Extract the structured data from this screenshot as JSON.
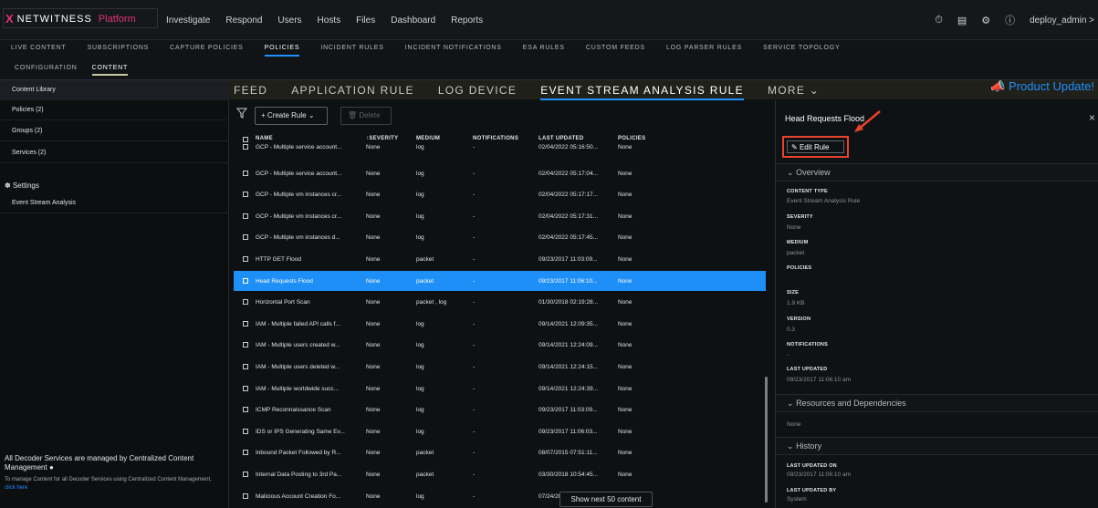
{
  "brand": {
    "logo_mark": "X",
    "name": "NETWITNESS",
    "product": "Platform"
  },
  "main_nav": [
    "Investigate",
    "Respond",
    "Users",
    "Hosts",
    "Files",
    "Dashboard",
    "Reports"
  ],
  "top_right": {
    "user": "deploy_admin >",
    "icons": [
      "timer-icon",
      "tasks-icon",
      "tools-icon",
      "help-icon"
    ]
  },
  "sub_nav": {
    "items": [
      "LIVE CONTENT",
      "SUBSCRIPTIONS",
      "CAPTURE POLICIES",
      "POLICIES",
      "INCIDENT RULES",
      "INCIDENT NOTIFICATIONS",
      "ESA RULES",
      "CUSTOM FEEDS",
      "LOG PARSER RULES",
      "SERVICE TOPOLOGY"
    ],
    "active": "POLICIES"
  },
  "tab_row3": {
    "items": [
      "CONFIGURATION",
      "CONTENT"
    ],
    "active": "CONTENT"
  },
  "sidebar": {
    "content_library": "Content Library",
    "policies": "Policies (2)",
    "groups": "Groups (2)",
    "services": "Services (2)",
    "settings": "Settings",
    "esa": "Event Stream Analysis",
    "note_heading": "All Decoder Services are managed by Centralized Content Management",
    "note_text": "To manage Content for all Decoder Services using Centralized Content Management,",
    "note_link": "click here"
  },
  "content_tabs": {
    "items": [
      "FEED",
      "APPLICATION RULE",
      "LOG DEVICE",
      "EVENT STREAM ANALYSIS RULE",
      "MORE"
    ],
    "active": "EVENT STREAM ANALYSIS RULE",
    "product_update": "Product Update!"
  },
  "toolbar": {
    "create_rule": "+ Create Rule",
    "delete": "Delete"
  },
  "table": {
    "headers": {
      "name": "NAME",
      "severity": "SEVERITY",
      "medium": "MEDIUM",
      "notifications": "NOTIFICATIONS",
      "last_updated": "LAST UPDATED",
      "policies": "POLICIES"
    },
    "rows": [
      {
        "name": "GCP - Multiple service account...",
        "severity": "None",
        "medium": "log",
        "notifications": "-",
        "last_updated": "02/04/2022 05:16:50...",
        "policies": "None"
      },
      {
        "name": "GCP - Multiple service account...",
        "severity": "None",
        "medium": "log",
        "notifications": "-",
        "last_updated": "02/04/2022 05:17:04...",
        "policies": "None"
      },
      {
        "name": "GCP - Multiple vm instances cr...",
        "severity": "None",
        "medium": "log",
        "notifications": "-",
        "last_updated": "02/04/2022 05:17:17...",
        "policies": "None"
      },
      {
        "name": "GCP - Multiple vm instances cr...",
        "severity": "None",
        "medium": "log",
        "notifications": "-",
        "last_updated": "02/04/2022 05:17:31...",
        "policies": "None"
      },
      {
        "name": "GCP - Multiple vm instances d...",
        "severity": "None",
        "medium": "log",
        "notifications": "-",
        "last_updated": "02/04/2022 05:17:45...",
        "policies": "None"
      },
      {
        "name": "HTTP GET Flood",
        "severity": "None",
        "medium": "packet",
        "notifications": "-",
        "last_updated": "09/23/2017 11:03:09...",
        "policies": "None"
      },
      {
        "name": "Head Requests Flood",
        "severity": "None",
        "medium": "packet",
        "notifications": "-",
        "last_updated": "09/23/2017 11:06:10...",
        "policies": "None"
      },
      {
        "name": "Horizontal Port Scan",
        "severity": "None",
        "medium": "packet , log",
        "notifications": "-",
        "last_updated": "01/30/2018 02:19:28...",
        "policies": "None"
      },
      {
        "name": "IAM - Multiple failed API calls f...",
        "severity": "None",
        "medium": "log",
        "notifications": "-",
        "last_updated": "09/14/2021 12:09:35...",
        "policies": "None"
      },
      {
        "name": "IAM - Multiple users created w...",
        "severity": "None",
        "medium": "log",
        "notifications": "-",
        "last_updated": "09/14/2021 12:24:09...",
        "policies": "None"
      },
      {
        "name": "IAM - Multiple users deleted w...",
        "severity": "None",
        "medium": "log",
        "notifications": "-",
        "last_updated": "09/14/2021 12:24:15...",
        "policies": "None"
      },
      {
        "name": "IAM - Multiple worldwide succ...",
        "severity": "None",
        "medium": "log",
        "notifications": "-",
        "last_updated": "09/14/2021 12:24:39...",
        "policies": "None"
      },
      {
        "name": "ICMP Reconnaissance Scan",
        "severity": "None",
        "medium": "log",
        "notifications": "-",
        "last_updated": "09/23/2017 11:03:09...",
        "policies": "None"
      },
      {
        "name": "IDS or IPS Generating Same Ev...",
        "severity": "None",
        "medium": "log",
        "notifications": "-",
        "last_updated": "09/23/2017 11:06:03...",
        "policies": "None"
      },
      {
        "name": "Inbound Packet Followed by R...",
        "severity": "None",
        "medium": "packet",
        "notifications": "-",
        "last_updated": "08/07/2015 07:51:11...",
        "policies": "None"
      },
      {
        "name": "Internal Data Posting to 3rd Pa...",
        "severity": "None",
        "medium": "packet",
        "notifications": "-",
        "last_updated": "03/30/2018 10:54:45...",
        "policies": "None"
      },
      {
        "name": "Malicious Account Creation Fo...",
        "severity": "None",
        "medium": "log",
        "notifications": "-",
        "last_updated": "07/24/2018 11:01:16...",
        "policies": "None"
      }
    ],
    "selected_index": 6,
    "show_next": "Show next 50 content"
  },
  "detail": {
    "title": "Head Requests Flood",
    "edit_rule": "Edit Rule",
    "overview": "Overview",
    "fields": [
      {
        "label": "CONTENT TYPE",
        "value": "Event Stream Analysis Rule"
      },
      {
        "label": "SEVERITY",
        "value": "None"
      },
      {
        "label": "MEDIUM",
        "value": "packet"
      },
      {
        "label": "POLICIES",
        "value": ""
      },
      {
        "label": "SIZE",
        "value": "1.9 KB"
      },
      {
        "label": "VERSION",
        "value": "0.3"
      },
      {
        "label": "NOTIFICATIONS",
        "value": "-"
      },
      {
        "label": "LAST UPDATED",
        "value": "09/23/2017 11:06:10 am"
      }
    ],
    "resources": "Resources and Dependencies",
    "resources_value": "None",
    "history": "History",
    "history_fields": [
      {
        "label": "LAST UPDATED ON",
        "value": "09/23/2017 11:06:10 am"
      },
      {
        "label": "LAST UPDATED BY",
        "value": "System"
      }
    ]
  },
  "colors": {
    "accent": "#1e8ff7",
    "brand": "#e0317a",
    "highlight_box": "#e8432a"
  }
}
